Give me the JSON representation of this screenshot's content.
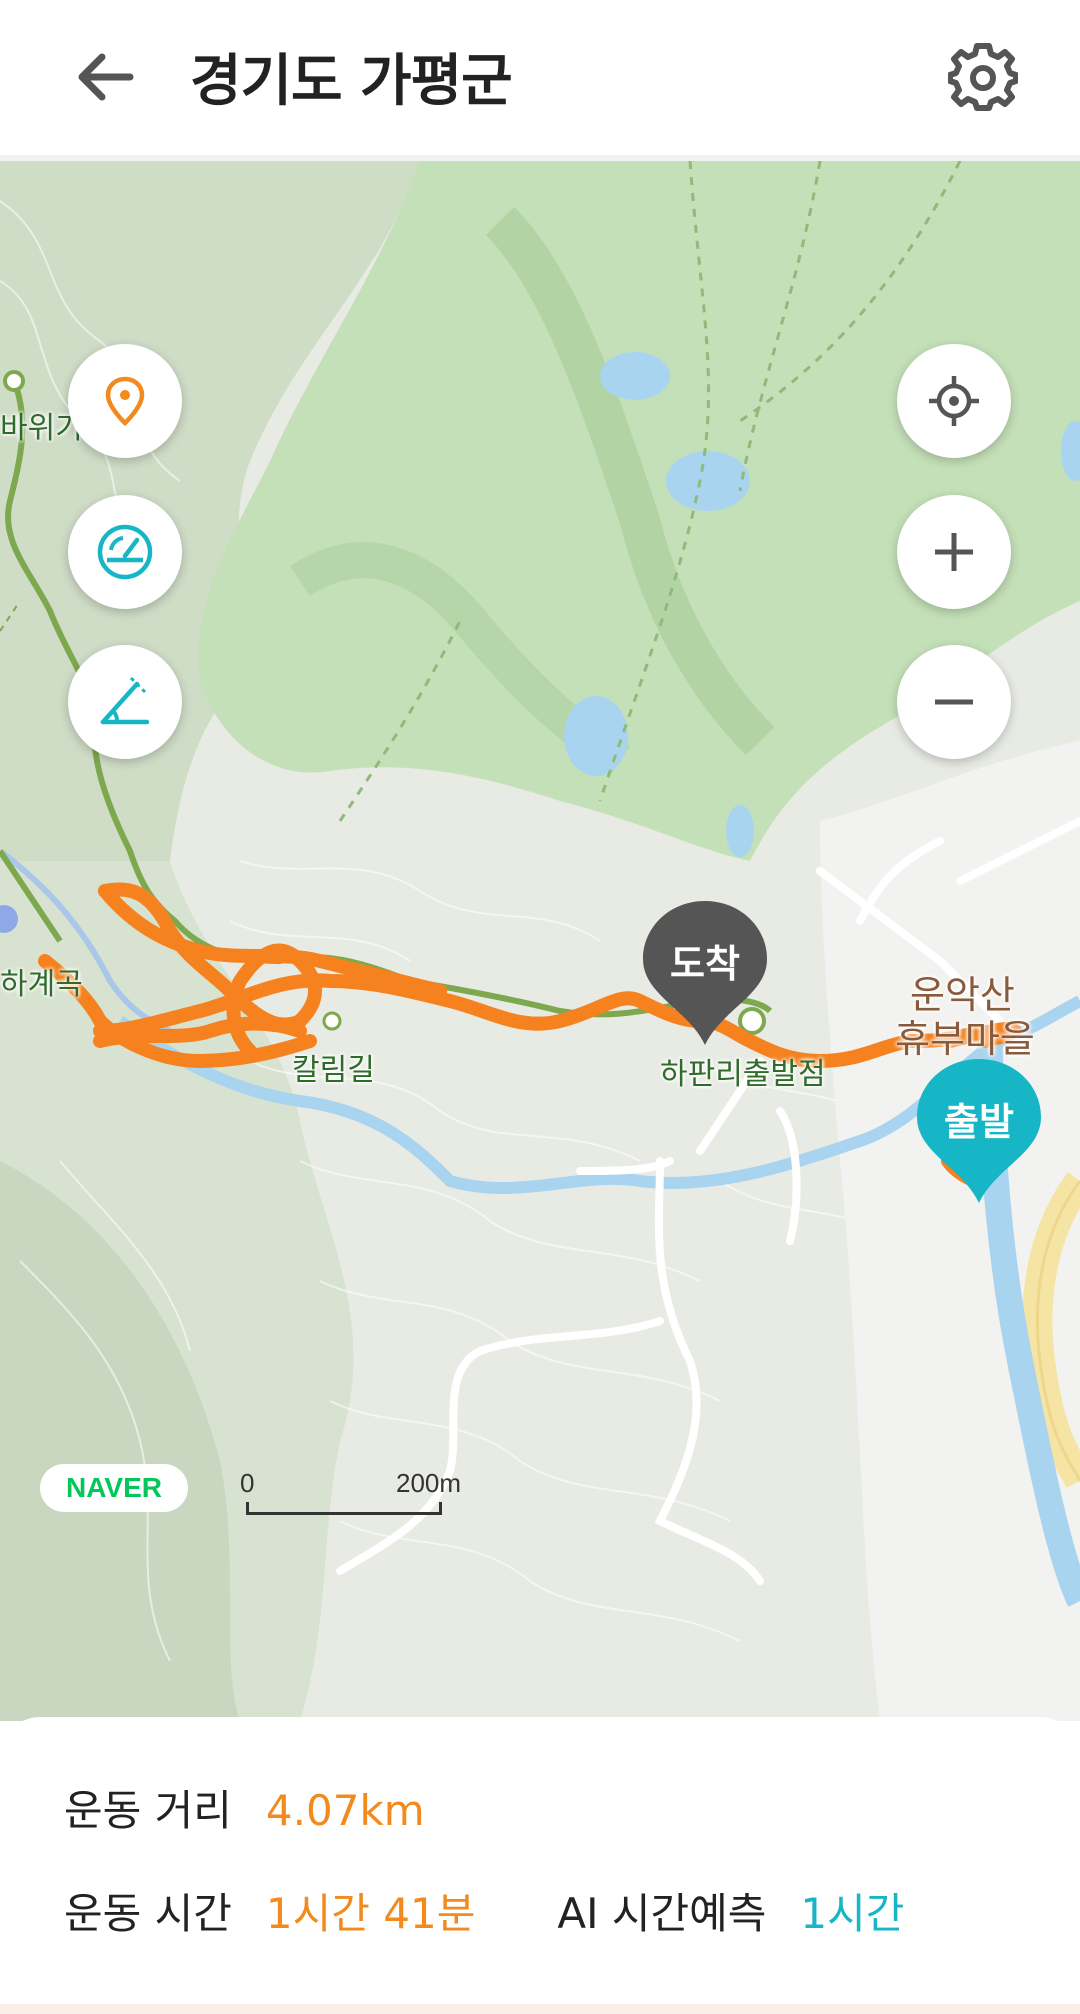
{
  "header": {
    "title": "경기도 가평군",
    "back_icon": "arrow-left-icon",
    "settings_icon": "gear-icon"
  },
  "map": {
    "labels": {
      "place_top_left": "바위기",
      "place_left": "하계곡",
      "trail_name": "칼림길",
      "start_point_name": "하판리출발점",
      "village_line1": "운악산",
      "village_line2": "휴부마을"
    },
    "markers": {
      "arrival": "도착",
      "departure": "출발"
    },
    "controls_left": [
      "location-pin-icon",
      "speedometer-icon",
      "slope-angle-icon"
    ],
    "controls_right": [
      "my-location-icon",
      "zoom-in-icon",
      "zoom-out-icon"
    ],
    "attribution": "NAVER",
    "scale": {
      "start": "0",
      "end": "200m"
    },
    "colors": {
      "route": "#f5821f",
      "arrival_pin": "#555555",
      "departure_pin": "#17b6c6"
    }
  },
  "stats": {
    "distance_label": "운동 거리",
    "distance_value": "4.07km",
    "time_label": "운동 시간",
    "time_value": "1시간 41분",
    "ai_label": "AI 시간예측",
    "ai_value": "1시간"
  }
}
